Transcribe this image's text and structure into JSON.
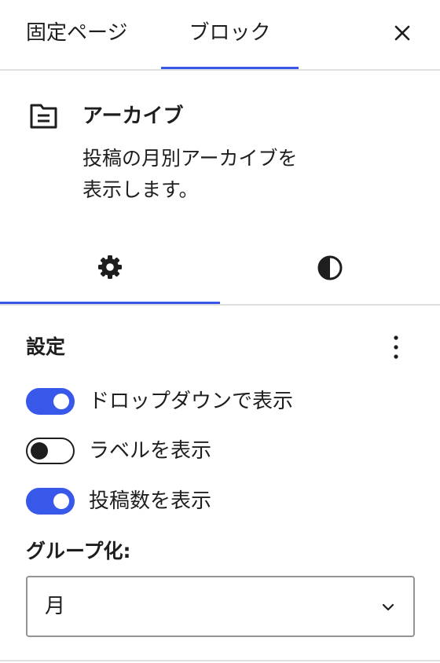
{
  "header": {
    "tabs": [
      {
        "label": "固定ページ",
        "active": false
      },
      {
        "label": "ブロック",
        "active": true
      }
    ],
    "close_icon": "close-icon"
  },
  "block": {
    "icon": "archive-folder-icon",
    "title": "アーカイブ",
    "description": "投稿の月別アーカイブを表示します。"
  },
  "inspector_tabs": [
    {
      "name": "settings",
      "icon": "gear-icon",
      "active": true
    },
    {
      "name": "styles",
      "icon": "contrast-icon",
      "active": false
    }
  ],
  "settings": {
    "title": "設定",
    "more_icon": "more-vertical-icon",
    "toggles": [
      {
        "label": "ドロップダウンで表示",
        "checked": true
      },
      {
        "label": "ラベルを表示",
        "checked": false
      },
      {
        "label": "投稿数を表示",
        "checked": true
      }
    ],
    "group_by": {
      "label": "グループ化:",
      "value": "月",
      "chevron_icon": "chevron-down-icon"
    }
  },
  "colors": {
    "accent": "#3858e9",
    "text": "#1e1e1e",
    "divider": "#e0e0e0",
    "border": "#949494"
  }
}
